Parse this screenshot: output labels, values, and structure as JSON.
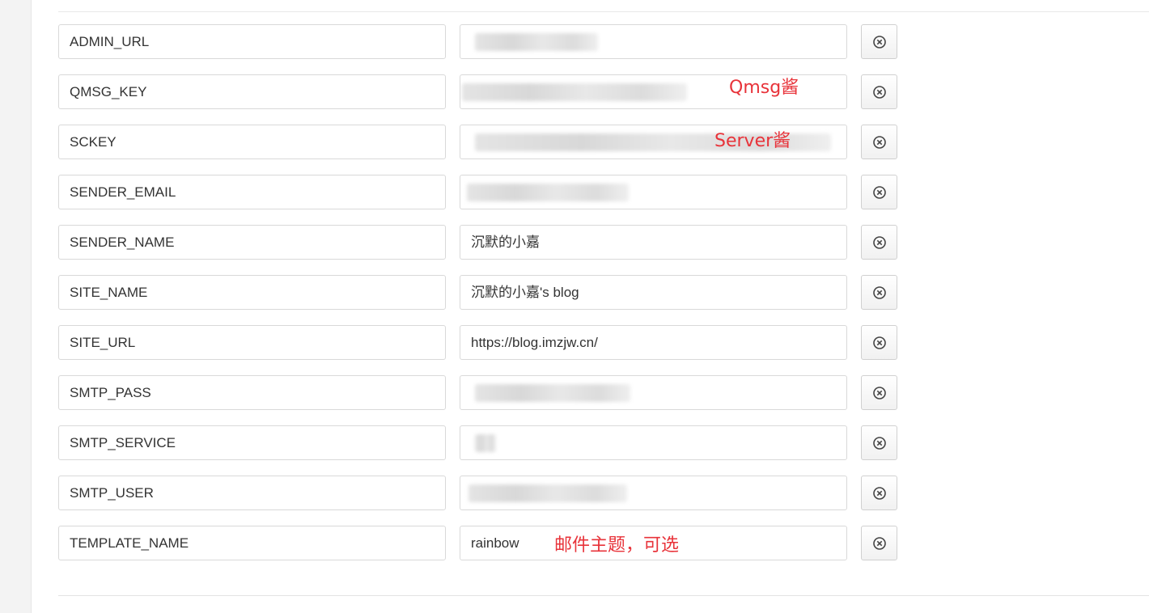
{
  "rows": [
    {
      "key": "ADMIN_URL",
      "value": "",
      "note": ""
    },
    {
      "key": "QMSG_KEY",
      "value": "",
      "note": "Qmsg酱"
    },
    {
      "key": "SCKEY",
      "value": "",
      "note": "Server酱"
    },
    {
      "key": "SENDER_EMAIL",
      "value": "",
      "note": ""
    },
    {
      "key": "SENDER_NAME",
      "value": "沉默的小嘉",
      "note": ""
    },
    {
      "key": "SITE_NAME",
      "value": "沉默的小嘉's blog",
      "note": ""
    },
    {
      "key": "SITE_URL",
      "value": "https://blog.imzjw.cn/",
      "note": ""
    },
    {
      "key": "SMTP_PASS",
      "value": "",
      "note": ""
    },
    {
      "key": "SMTP_SERVICE",
      "value": "",
      "note": ""
    },
    {
      "key": "SMTP_USER",
      "value": "",
      "note": ""
    },
    {
      "key": "TEMPLATE_NAME",
      "value": "rainbow",
      "note": "邮件主题，可选"
    }
  ],
  "icons": {
    "delete": "close-circle-icon"
  },
  "colors": {
    "annotation": "#e8333a",
    "border": "#d9d9d9",
    "text": "#333333"
  }
}
